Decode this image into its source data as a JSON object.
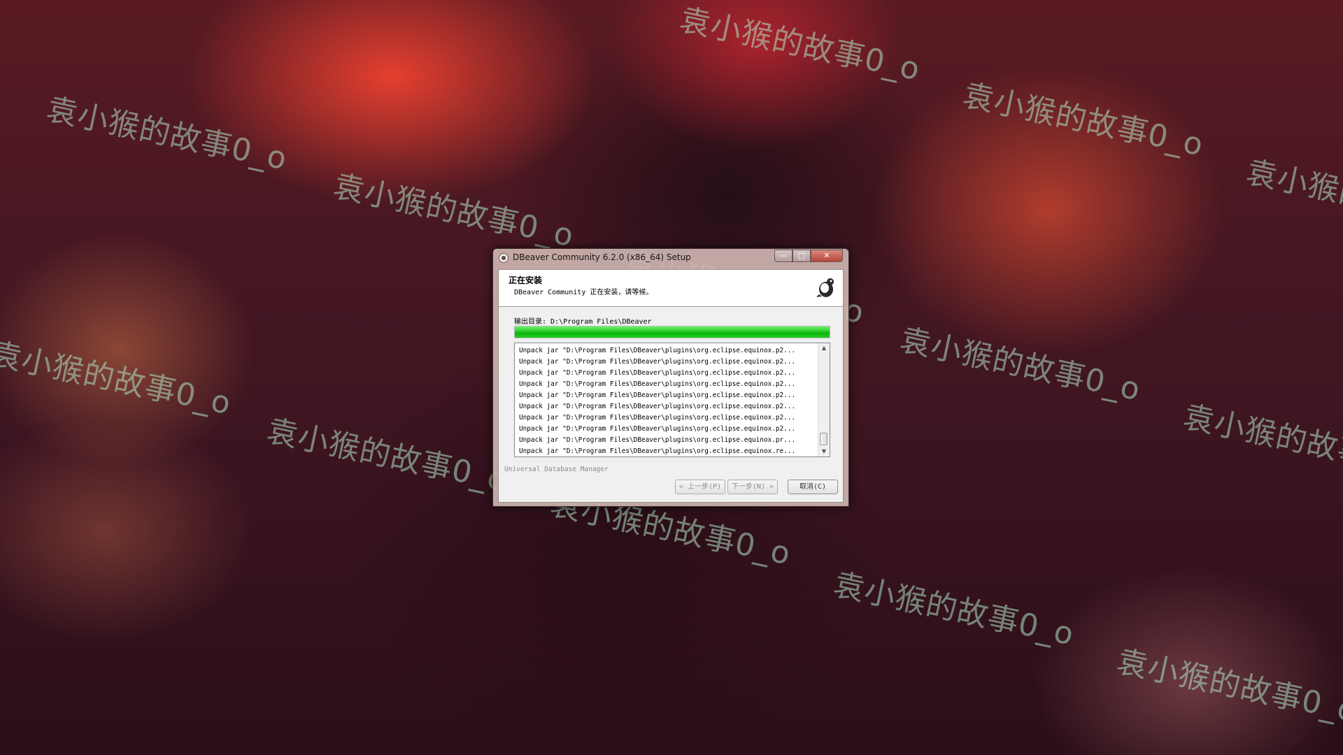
{
  "watermark_text": "袁小猴的故事0_o",
  "window": {
    "title": "DBeaver Community 6.2.0 (x86_64) Setup",
    "buttons": {
      "minimize": "—",
      "maximize": "□",
      "close": "✕"
    }
  },
  "header": {
    "title": "正在安装",
    "subtitle": "DBeaver Community 正在安装，请等候。",
    "logo_icon": "beaver-logo-icon"
  },
  "output": {
    "label": "输出目录: D:\\Program Files\\DBeaver"
  },
  "progress": {
    "value_percent": 100,
    "color": "#10c010"
  },
  "log": {
    "lines": [
      "Unpack jar \"D:\\Program Files\\DBeaver\\plugins\\org.eclipse.equinox.p2...",
      "Unpack jar \"D:\\Program Files\\DBeaver\\plugins\\org.eclipse.equinox.p2...",
      "Unpack jar \"D:\\Program Files\\DBeaver\\plugins\\org.eclipse.equinox.p2...",
      "Unpack jar \"D:\\Program Files\\DBeaver\\plugins\\org.eclipse.equinox.p2...",
      "Unpack jar \"D:\\Program Files\\DBeaver\\plugins\\org.eclipse.equinox.p2...",
      "Unpack jar \"D:\\Program Files\\DBeaver\\plugins\\org.eclipse.equinox.p2...",
      "Unpack jar \"D:\\Program Files\\DBeaver\\plugins\\org.eclipse.equinox.p2...",
      "Unpack jar \"D:\\Program Files\\DBeaver\\plugins\\org.eclipse.equinox.p2...",
      "Unpack jar \"D:\\Program Files\\DBeaver\\plugins\\org.eclipse.equinox.pr...",
      "Unpack jar \"D:\\Program Files\\DBeaver\\plugins\\org.eclipse.equinox.re..."
    ]
  },
  "footer": {
    "brand": "Universal Database Manager",
    "back_label": "< 上一步(P)",
    "next_label": "下一步(N) >",
    "cancel_label": "取消(C)"
  }
}
